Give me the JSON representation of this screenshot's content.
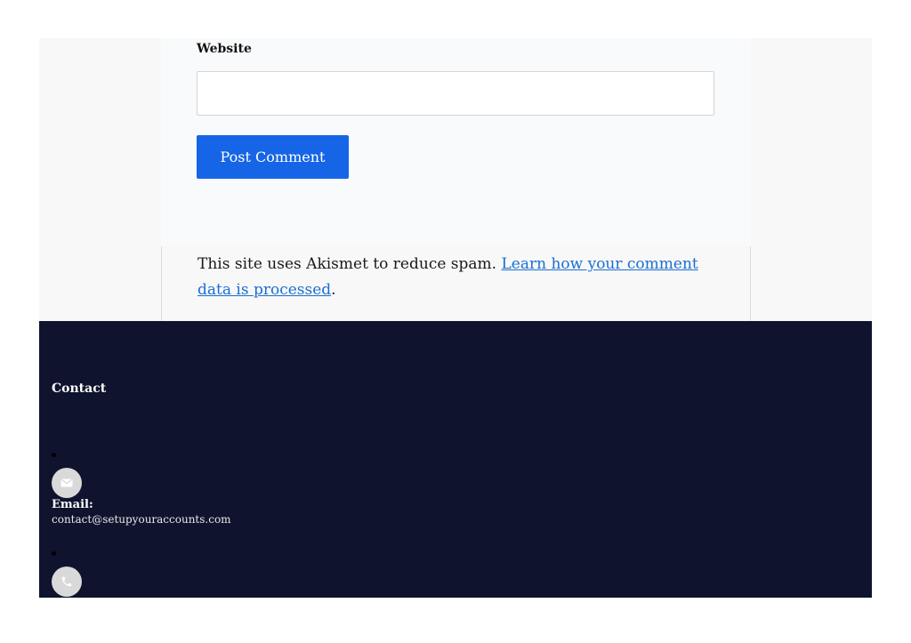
{
  "comment_form": {
    "website_label": "Website",
    "website_value": "",
    "submit_label": "Post Comment",
    "accent_color": "#1565e6"
  },
  "akismet": {
    "text": "This site uses Akismet to reduce spam. ",
    "link_text": "Learn how your comment data is processed",
    "suffix": "."
  },
  "footer": {
    "title": "Contact",
    "background_color": "#0f132d",
    "items": [
      {
        "icon": "envelope-icon",
        "label": "Email:",
        "value": "contact@setupyouraccounts.com"
      },
      {
        "icon": "phone-icon"
      }
    ]
  }
}
